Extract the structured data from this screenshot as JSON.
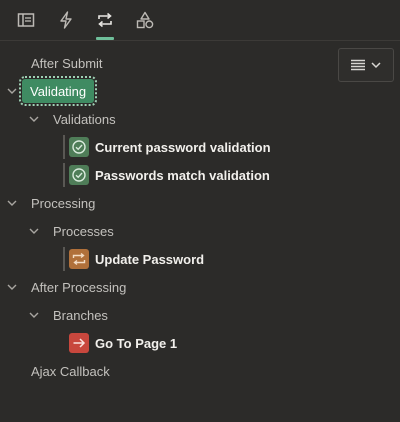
{
  "toolbar": {
    "tabs": [
      {
        "icon": "rendering-tree-icon",
        "active": false
      },
      {
        "icon": "dynamic-actions-icon",
        "active": false
      },
      {
        "icon": "processing-icon",
        "active": true
      },
      {
        "icon": "shared-components-icon",
        "active": false
      }
    ],
    "menu_icon": "menu-lines-icon",
    "accent": "#6fbf9a"
  },
  "tree": {
    "after_submit": "After Submit",
    "validating": "Validating",
    "validations": "Validations",
    "current_password_validation": "Current password validation",
    "passwords_match_validation": "Passwords match validation",
    "processing": "Processing",
    "processes": "Processes",
    "update_password": "Update Password",
    "after_processing": "After Processing",
    "branches": "Branches",
    "go_to_page_1": "Go To Page 1",
    "ajax_callback": "Ajax Callback"
  },
  "colors": {
    "validation_icon": "#4f7d58",
    "process_icon": "#b0703a",
    "branch_icon": "#c8473d",
    "selected_badge": "#3f8b62"
  }
}
